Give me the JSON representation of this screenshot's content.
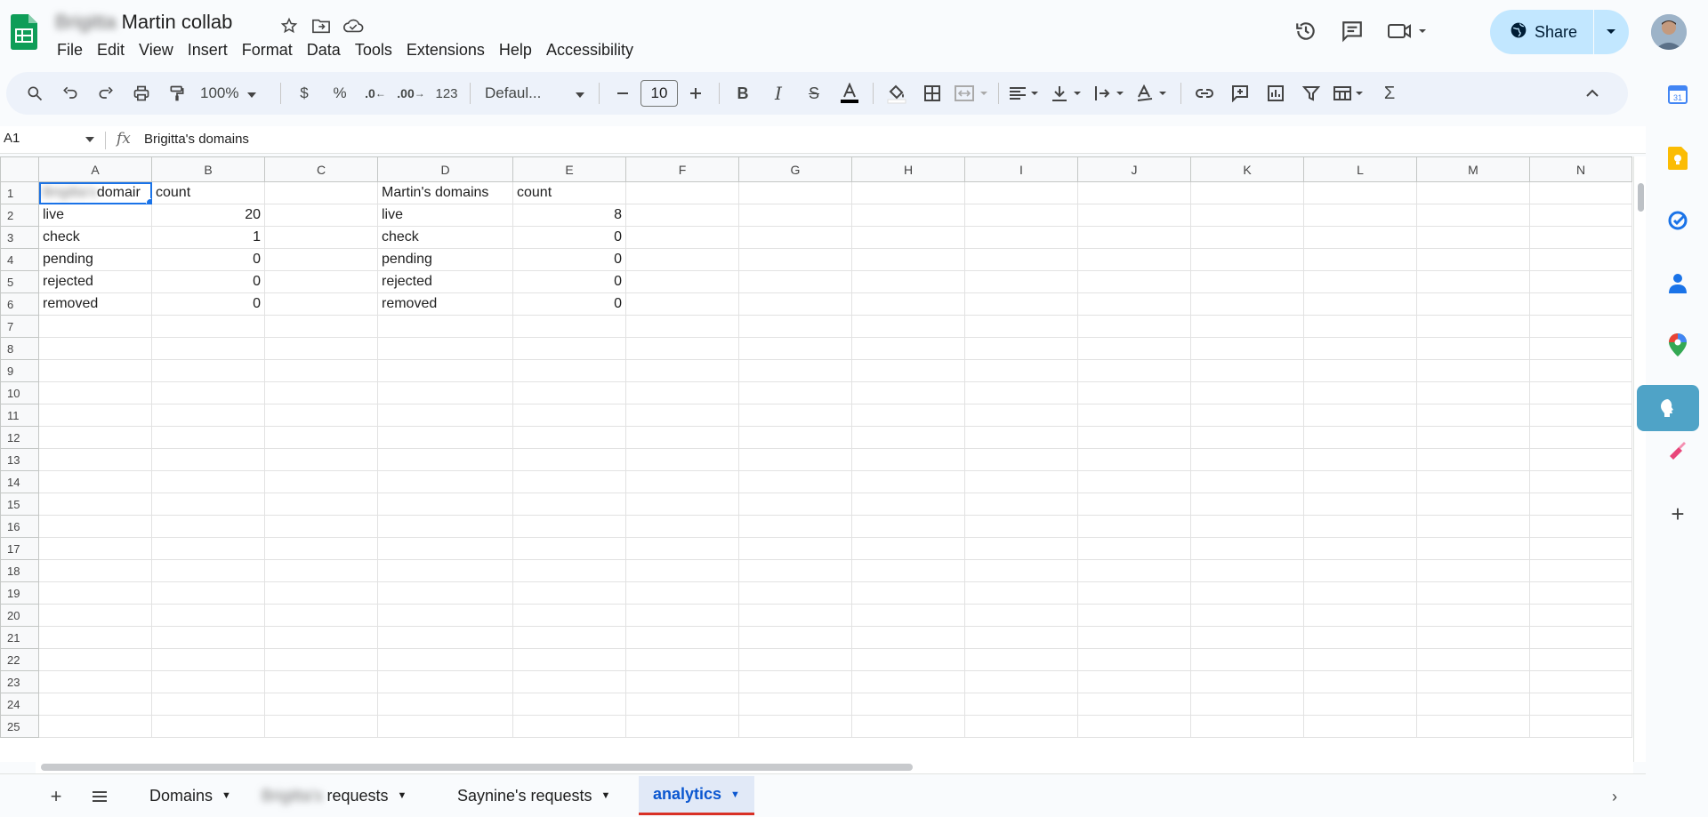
{
  "document": {
    "title_redacted": "Brigitta",
    "title_visible": "Martin collab"
  },
  "menu": [
    "File",
    "Edit",
    "View",
    "Insert",
    "Format",
    "Data",
    "Tools",
    "Extensions",
    "Help",
    "Accessibility"
  ],
  "share": {
    "label": "Share"
  },
  "toolbar": {
    "zoom": "100%",
    "currency": "$",
    "percent": "%",
    "dec_decrease": ".0",
    "dec_increase": ".00",
    "number_format": "123",
    "font": "Defaul...",
    "font_size": "10"
  },
  "formula_bar": {
    "cell_ref": "A1",
    "fx": "fx",
    "content": "Brigitta's domains"
  },
  "grid": {
    "columns": [
      "A",
      "B",
      "C",
      "D",
      "E",
      "F",
      "G",
      "H",
      "I",
      "J",
      "K",
      "L",
      "M",
      "N"
    ],
    "row_numbers": [
      "1",
      "2",
      "3",
      "4",
      "5",
      "6",
      "7",
      "8",
      "9",
      "10",
      "11",
      "12",
      "13",
      "14",
      "15",
      "16",
      "17",
      "18",
      "19",
      "20",
      "21",
      "22",
      "23",
      "24",
      "25"
    ],
    "a1_redacted": "Brigitta's",
    "a1_visible": "domair",
    "b1": "count",
    "d1": "Martin's domains",
    "e1": "count",
    "left_rows": [
      {
        "label": "live",
        "count": "20"
      },
      {
        "label": "check",
        "count": "1"
      },
      {
        "label": "pending",
        "count": "0"
      },
      {
        "label": "rejected",
        "count": "0"
      },
      {
        "label": "removed",
        "count": "0"
      }
    ],
    "right_rows": [
      {
        "label": "live",
        "count": "8"
      },
      {
        "label": "check",
        "count": "0"
      },
      {
        "label": "pending",
        "count": "0"
      },
      {
        "label": "rejected",
        "count": "0"
      },
      {
        "label": "removed",
        "count": "0"
      }
    ]
  },
  "sheets": [
    {
      "name": "Domains"
    },
    {
      "name_redacted": "Brigitta's",
      "name": "requests"
    },
    {
      "name": "Saynine's requests"
    },
    {
      "name": "analytics",
      "active": true
    }
  ],
  "colors": {
    "accent": "#0b57d0",
    "share_bg": "#c2e7ff",
    "toolbar_bg": "#edf2fa",
    "selection": "#1a73e8",
    "active_tab_underline": "#d93025"
  }
}
